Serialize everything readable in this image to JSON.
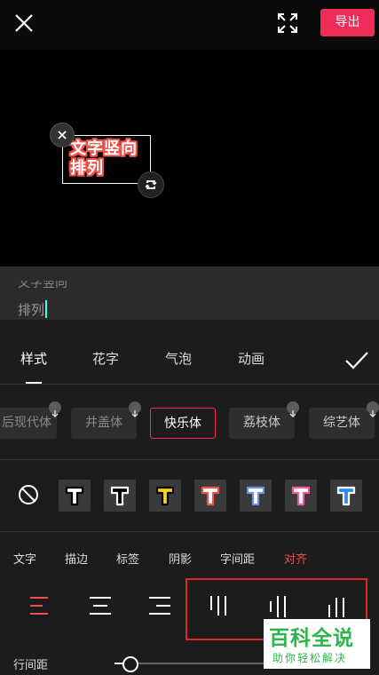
{
  "topbar": {
    "export_label": "导出"
  },
  "preview": {
    "sticker_line1": "文字竖向",
    "sticker_line2": "排列"
  },
  "input": {
    "line1": "文字竖向",
    "line2": "排列"
  },
  "tabs": [
    {
      "label": "样式",
      "active": true
    },
    {
      "label": "花字",
      "active": false
    },
    {
      "label": "气泡",
      "active": false
    },
    {
      "label": "动画",
      "active": false
    }
  ],
  "fonts": [
    {
      "label": "后现代体",
      "download": true
    },
    {
      "label": "井盖体",
      "download": true
    },
    {
      "label": "快乐体",
      "selected": true
    },
    {
      "label": "荔枝体",
      "download": true
    },
    {
      "label": "综艺体",
      "download": true
    }
  ],
  "style_presets": [
    {
      "name": "white-black",
      "fill": "#ffffff",
      "stroke": "#000000"
    },
    {
      "name": "black-white",
      "fill": "#000000",
      "stroke": "#ffffff"
    },
    {
      "name": "yellow-black",
      "fill": "#f4d21f",
      "stroke": "#000000"
    },
    {
      "name": "white-red",
      "fill": "#ffffff",
      "stroke": "#f0524a"
    },
    {
      "name": "white-blue",
      "fill": "#ffffff",
      "stroke": "#6a8fe0"
    },
    {
      "name": "white-pink",
      "fill": "#ffffff",
      "stroke": "#f05a9a"
    },
    {
      "name": "blue-white",
      "fill": "#2a8be8",
      "stroke": "#ffffff"
    }
  ],
  "subtabs": [
    {
      "label": "文字",
      "active": false
    },
    {
      "label": "描边",
      "active": false
    },
    {
      "label": "标签",
      "active": false
    },
    {
      "label": "阴影",
      "active": false
    },
    {
      "label": "字间距",
      "active": false
    },
    {
      "label": "对齐",
      "active": true
    }
  ],
  "line_spacing": {
    "label": "行间距",
    "value": 0.1
  },
  "watermark": {
    "main": "百科全说",
    "sub": "助你轻松解决"
  },
  "colors": {
    "accent": "#f02c5b",
    "highlight_box": "#e0262b",
    "watermark": "#2db44a"
  }
}
